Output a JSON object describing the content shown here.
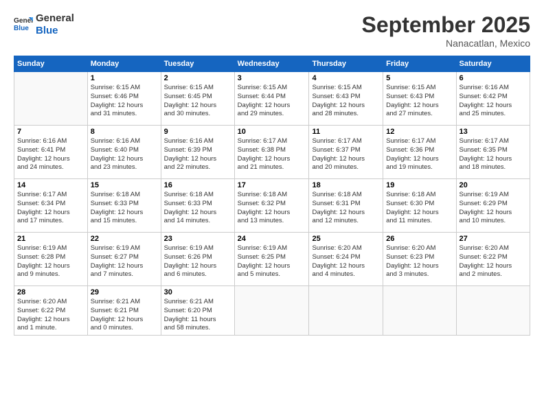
{
  "header": {
    "logo_line1": "General",
    "logo_line2": "Blue",
    "month": "September 2025",
    "location": "Nanacatlan, Mexico"
  },
  "weekdays": [
    "Sunday",
    "Monday",
    "Tuesday",
    "Wednesday",
    "Thursday",
    "Friday",
    "Saturday"
  ],
  "weeks": [
    [
      {
        "day": "",
        "info": ""
      },
      {
        "day": "1",
        "info": "Sunrise: 6:15 AM\nSunset: 6:46 PM\nDaylight: 12 hours\nand 31 minutes."
      },
      {
        "day": "2",
        "info": "Sunrise: 6:15 AM\nSunset: 6:45 PM\nDaylight: 12 hours\nand 30 minutes."
      },
      {
        "day": "3",
        "info": "Sunrise: 6:15 AM\nSunset: 6:44 PM\nDaylight: 12 hours\nand 29 minutes."
      },
      {
        "day": "4",
        "info": "Sunrise: 6:15 AM\nSunset: 6:43 PM\nDaylight: 12 hours\nand 28 minutes."
      },
      {
        "day": "5",
        "info": "Sunrise: 6:15 AM\nSunset: 6:43 PM\nDaylight: 12 hours\nand 27 minutes."
      },
      {
        "day": "6",
        "info": "Sunrise: 6:16 AM\nSunset: 6:42 PM\nDaylight: 12 hours\nand 25 minutes."
      }
    ],
    [
      {
        "day": "7",
        "info": "Sunrise: 6:16 AM\nSunset: 6:41 PM\nDaylight: 12 hours\nand 24 minutes."
      },
      {
        "day": "8",
        "info": "Sunrise: 6:16 AM\nSunset: 6:40 PM\nDaylight: 12 hours\nand 23 minutes."
      },
      {
        "day": "9",
        "info": "Sunrise: 6:16 AM\nSunset: 6:39 PM\nDaylight: 12 hours\nand 22 minutes."
      },
      {
        "day": "10",
        "info": "Sunrise: 6:17 AM\nSunset: 6:38 PM\nDaylight: 12 hours\nand 21 minutes."
      },
      {
        "day": "11",
        "info": "Sunrise: 6:17 AM\nSunset: 6:37 PM\nDaylight: 12 hours\nand 20 minutes."
      },
      {
        "day": "12",
        "info": "Sunrise: 6:17 AM\nSunset: 6:36 PM\nDaylight: 12 hours\nand 19 minutes."
      },
      {
        "day": "13",
        "info": "Sunrise: 6:17 AM\nSunset: 6:35 PM\nDaylight: 12 hours\nand 18 minutes."
      }
    ],
    [
      {
        "day": "14",
        "info": "Sunrise: 6:17 AM\nSunset: 6:34 PM\nDaylight: 12 hours\nand 17 minutes."
      },
      {
        "day": "15",
        "info": "Sunrise: 6:18 AM\nSunset: 6:33 PM\nDaylight: 12 hours\nand 15 minutes."
      },
      {
        "day": "16",
        "info": "Sunrise: 6:18 AM\nSunset: 6:33 PM\nDaylight: 12 hours\nand 14 minutes."
      },
      {
        "day": "17",
        "info": "Sunrise: 6:18 AM\nSunset: 6:32 PM\nDaylight: 12 hours\nand 13 minutes."
      },
      {
        "day": "18",
        "info": "Sunrise: 6:18 AM\nSunset: 6:31 PM\nDaylight: 12 hours\nand 12 minutes."
      },
      {
        "day": "19",
        "info": "Sunrise: 6:18 AM\nSunset: 6:30 PM\nDaylight: 12 hours\nand 11 minutes."
      },
      {
        "day": "20",
        "info": "Sunrise: 6:19 AM\nSunset: 6:29 PM\nDaylight: 12 hours\nand 10 minutes."
      }
    ],
    [
      {
        "day": "21",
        "info": "Sunrise: 6:19 AM\nSunset: 6:28 PM\nDaylight: 12 hours\nand 9 minutes."
      },
      {
        "day": "22",
        "info": "Sunrise: 6:19 AM\nSunset: 6:27 PM\nDaylight: 12 hours\nand 7 minutes."
      },
      {
        "day": "23",
        "info": "Sunrise: 6:19 AM\nSunset: 6:26 PM\nDaylight: 12 hours\nand 6 minutes."
      },
      {
        "day": "24",
        "info": "Sunrise: 6:19 AM\nSunset: 6:25 PM\nDaylight: 12 hours\nand 5 minutes."
      },
      {
        "day": "25",
        "info": "Sunrise: 6:20 AM\nSunset: 6:24 PM\nDaylight: 12 hours\nand 4 minutes."
      },
      {
        "day": "26",
        "info": "Sunrise: 6:20 AM\nSunset: 6:23 PM\nDaylight: 12 hours\nand 3 minutes."
      },
      {
        "day": "27",
        "info": "Sunrise: 6:20 AM\nSunset: 6:22 PM\nDaylight: 12 hours\nand 2 minutes."
      }
    ],
    [
      {
        "day": "28",
        "info": "Sunrise: 6:20 AM\nSunset: 6:22 PM\nDaylight: 12 hours\nand 1 minute."
      },
      {
        "day": "29",
        "info": "Sunrise: 6:21 AM\nSunset: 6:21 PM\nDaylight: 12 hours\nand 0 minutes."
      },
      {
        "day": "30",
        "info": "Sunrise: 6:21 AM\nSunset: 6:20 PM\nDaylight: 11 hours\nand 58 minutes."
      },
      {
        "day": "",
        "info": ""
      },
      {
        "day": "",
        "info": ""
      },
      {
        "day": "",
        "info": ""
      },
      {
        "day": "",
        "info": ""
      }
    ]
  ]
}
